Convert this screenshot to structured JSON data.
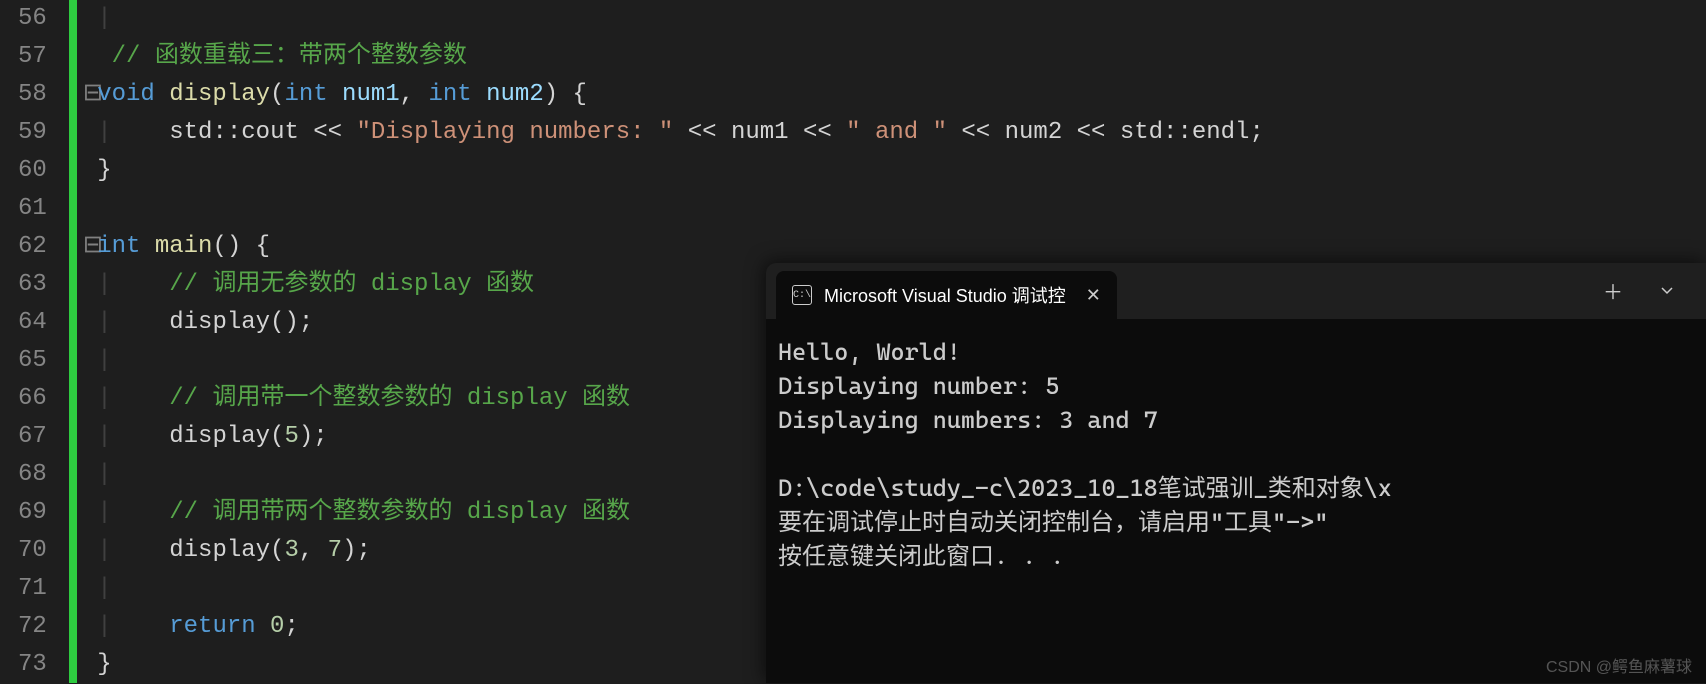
{
  "gutter": {
    "start": 56,
    "end": 73
  },
  "code": {
    "l56": "",
    "l57_comment": "// 函数重载三：带两个整数参数",
    "l58_void": "void",
    "l58_fn": " display",
    "l58_paren_open": "(",
    "l58_int1": "int",
    "l58_num1": " num1",
    "l58_comma": ", ",
    "l58_int2": "int",
    "l58_num2": " num2",
    "l58_end": ") {",
    "l59_std": "    std",
    "l59_cout": "::cout << ",
    "l59_str1": "\"Displaying numbers: \"",
    "l59_mid1": " << num1 << ",
    "l59_str2": "\" and \"",
    "l59_mid2": " << num2 << std::endl;",
    "l60_brace": "}",
    "l62_int": "int",
    "l62_main": " main",
    "l62_rest": "() {",
    "l63_comment": "    // 调用无参数的 display 函数",
    "l64_call": "    display();",
    "l66_comment": "    // 调用带一个整数参数的 display 函数",
    "l67_call_a": "    display(",
    "l67_num": "5",
    "l67_call_b": ");",
    "l69_comment": "    // 调用带两个整数参数的 display 函数",
    "l70_call_a": "    display(",
    "l70_num1": "3",
    "l70_comma": ", ",
    "l70_num2": "7",
    "l70_call_b": ");",
    "l72_ret": "    return",
    "l72_zero": " 0",
    "l72_semi": ";",
    "l73_brace": "}"
  },
  "console": {
    "tab_title": "Microsoft Visual Studio 调试控",
    "tab_icon_text": "C:\\",
    "output": [
      "Hello, World!",
      "Displaying number: 5",
      "Displaying numbers: 3 and 7",
      "",
      "D:\\code\\study_-c\\2023_10_18笔试强训_类和对象\\x",
      "要在调试停止时自动关闭控制台，请启用\"工具\"->\"",
      "按任意键关闭此窗口. . ."
    ]
  },
  "watermark": "CSDN @鳄鱼麻薯球"
}
